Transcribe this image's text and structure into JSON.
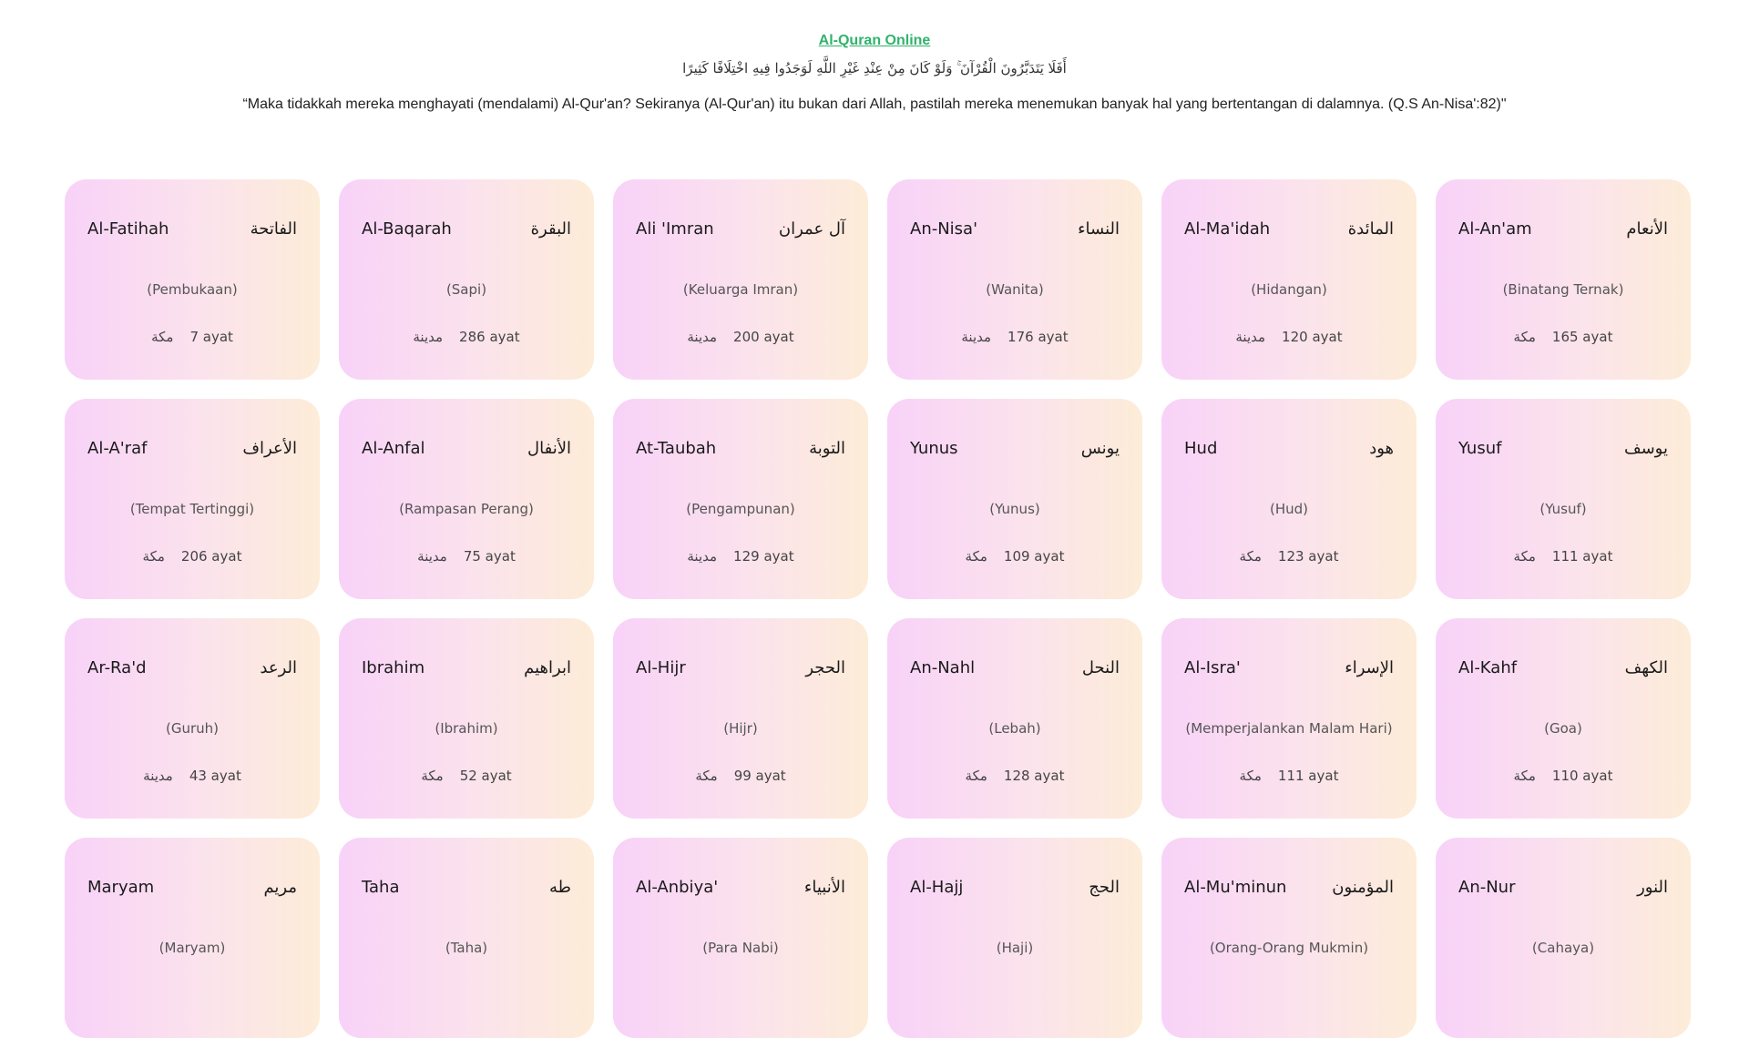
{
  "header": {
    "title": "Al-Quran Online",
    "verse_arabic": "أَفَلَا يَتَدَبَّرُونَ الْقُرْآنَ ۚ وَلَوْ كَانَ مِنْ عِنْدِ غَيْرِ اللَّهِ لَوَجَدُوا فِيهِ اخْتِلَافًا كَثِيرًا",
    "translation": "“Maka tidakkah mereka menghayati (mendalami) Al-Qur'an? Sekiranya (Al-Qur'an) itu bukan dari Allah, pastilah mereka menemukan banyak hal yang bertentangan di dalamnya. (Q.S An-Nisa':82)\""
  },
  "colors": {
    "title": "#2fb36b",
    "card_gradient_start": "#f8d2f8",
    "card_gradient_end": "#fdecd8"
  },
  "surahs": [
    {
      "latin": "Al-Fatihah",
      "arabic": "الفاتحة",
      "meaning": "(Pembukaan)",
      "place": "مكة",
      "ayat": "7 ayat"
    },
    {
      "latin": "Al-Baqarah",
      "arabic": "البقرة",
      "meaning": "(Sapi)",
      "place": "مدينة",
      "ayat": "286 ayat"
    },
    {
      "latin": "Ali 'Imran",
      "arabic": "آل عمران",
      "meaning": "(Keluarga Imran)",
      "place": "مدينة",
      "ayat": "200 ayat"
    },
    {
      "latin": "An-Nisa'",
      "arabic": "النساء",
      "meaning": "(Wanita)",
      "place": "مدينة",
      "ayat": "176 ayat"
    },
    {
      "latin": "Al-Ma'idah",
      "arabic": "المائدة",
      "meaning": "(Hidangan)",
      "place": "مدينة",
      "ayat": "120 ayat"
    },
    {
      "latin": "Al-An'am",
      "arabic": "الأنعام",
      "meaning": "(Binatang Ternak)",
      "place": "مكة",
      "ayat": "165 ayat"
    },
    {
      "latin": "Al-A'raf",
      "arabic": "الأعراف",
      "meaning": "(Tempat Tertinggi)",
      "place": "مكة",
      "ayat": "206 ayat"
    },
    {
      "latin": "Al-Anfal",
      "arabic": "الأنفال",
      "meaning": "(Rampasan Perang)",
      "place": "مدينة",
      "ayat": "75 ayat"
    },
    {
      "latin": "At-Taubah",
      "arabic": "التوبة",
      "meaning": "(Pengampunan)",
      "place": "مدينة",
      "ayat": "129 ayat"
    },
    {
      "latin": "Yunus",
      "arabic": "يونس",
      "meaning": "(Yunus)",
      "place": "مكة",
      "ayat": "109 ayat"
    },
    {
      "latin": "Hud",
      "arabic": "هود",
      "meaning": "(Hud)",
      "place": "مكة",
      "ayat": "123 ayat"
    },
    {
      "latin": "Yusuf",
      "arabic": "يوسف",
      "meaning": "(Yusuf)",
      "place": "مكة",
      "ayat": "111 ayat"
    },
    {
      "latin": "Ar-Ra'd",
      "arabic": "الرعد",
      "meaning": "(Guruh)",
      "place": "مدينة",
      "ayat": "43 ayat"
    },
    {
      "latin": "Ibrahim",
      "arabic": "ابراهيم",
      "meaning": "(Ibrahim)",
      "place": "مكة",
      "ayat": "52 ayat"
    },
    {
      "latin": "Al-Hijr",
      "arabic": "الحجر",
      "meaning": "(Hijr)",
      "place": "مكة",
      "ayat": "99 ayat"
    },
    {
      "latin": "An-Nahl",
      "arabic": "النحل",
      "meaning": "(Lebah)",
      "place": "مكة",
      "ayat": "128 ayat"
    },
    {
      "latin": "Al-Isra'",
      "arabic": "الإسراء",
      "meaning": "(Memperjalankan Malam Hari)",
      "place": "مكة",
      "ayat": "111 ayat"
    },
    {
      "latin": "Al-Kahf",
      "arabic": "الكهف",
      "meaning": "(Goa)",
      "place": "مكة",
      "ayat": "110 ayat"
    },
    {
      "latin": "Maryam",
      "arabic": "مريم",
      "meaning": "(Maryam)"
    },
    {
      "latin": "Taha",
      "arabic": "طه",
      "meaning": "(Taha)"
    },
    {
      "latin": "Al-Anbiya'",
      "arabic": "الأنبياء",
      "meaning": "(Para Nabi)"
    },
    {
      "latin": "Al-Hajj",
      "arabic": "الحج",
      "meaning": "(Haji)"
    },
    {
      "latin": "Al-Mu'minun",
      "arabic": "المؤمنون",
      "meaning": "(Orang-Orang Mukmin)"
    },
    {
      "latin": "An-Nur",
      "arabic": "النور",
      "meaning": "(Cahaya)"
    }
  ]
}
